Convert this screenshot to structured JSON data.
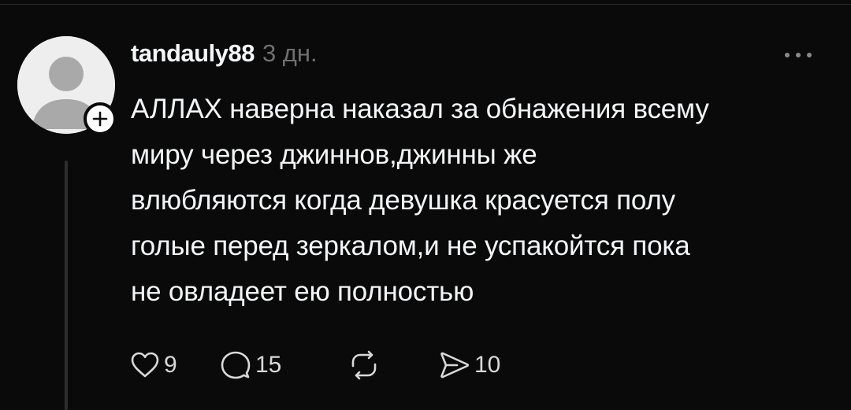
{
  "post": {
    "username": "tandauly88",
    "timestamp": "3 дн.",
    "text": "АЛЛАХ наверна наказал за обнажения всему\nмиру через джиннов,джинны же\nвлюбляются когда девушка красуется полу\nголые перед зеркалом,и не успакойтся пока\nне овладеет ею полностью",
    "avatar_icon": "default-avatar-icon",
    "follow_icon": "plus-icon",
    "more_icon": "more-horizontal-icon"
  },
  "actions": {
    "like": {
      "icon": "heart-icon",
      "count": "9"
    },
    "comment": {
      "icon": "comment-icon",
      "count": "15"
    },
    "repost": {
      "icon": "repost-icon",
      "count": ""
    },
    "share": {
      "icon": "send-icon",
      "count": "10"
    }
  },
  "colors": {
    "background": "#0a0a0a",
    "text_primary": "#f3f5f7",
    "text_secondary": "#6f6f6f",
    "thread_line": "#2e2e2e"
  }
}
